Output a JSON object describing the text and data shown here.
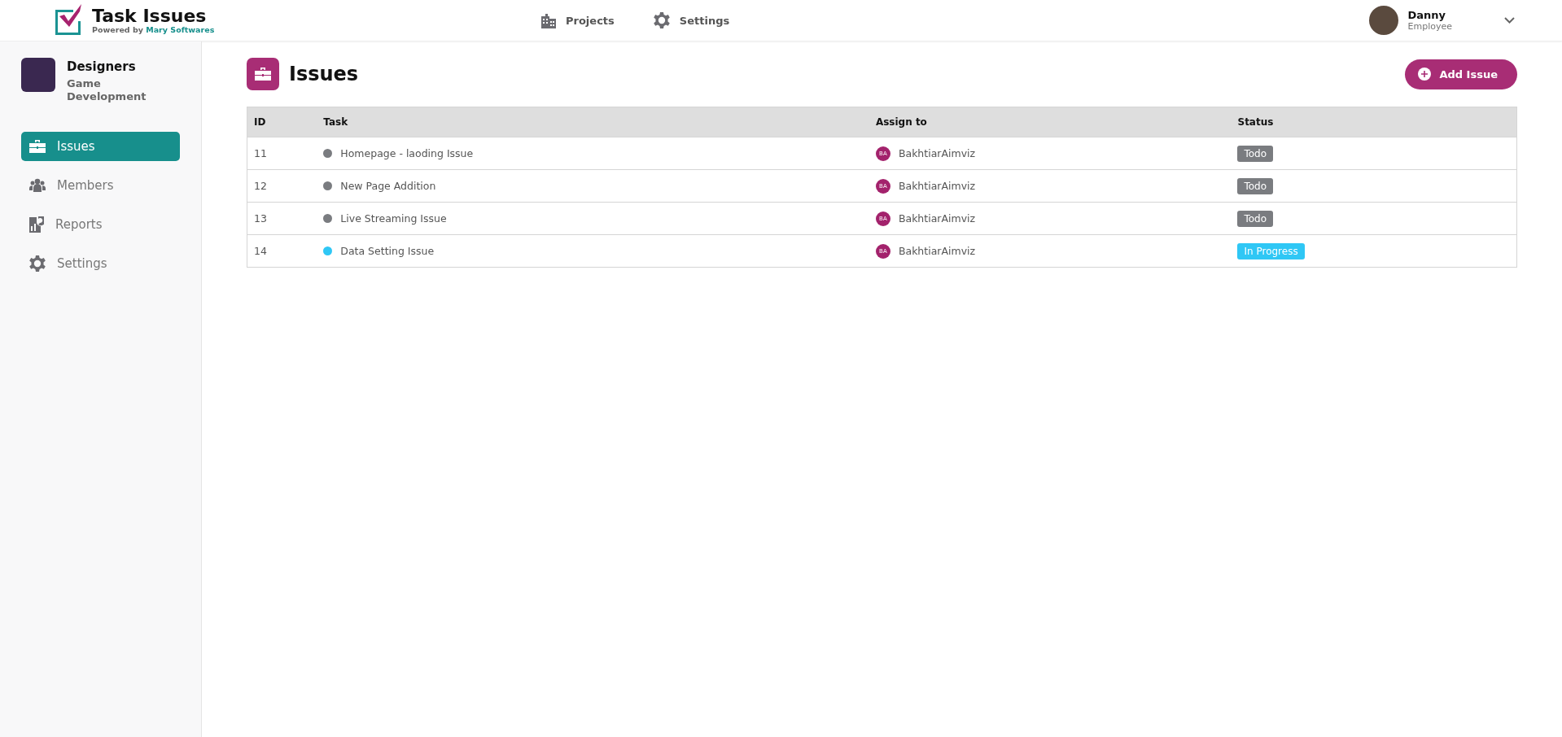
{
  "brand": {
    "title": "Task Issues",
    "powered_prefix": "Powered by",
    "powered_name": "Mary Softwares"
  },
  "nav": [
    {
      "label": "Projects",
      "kind": "building"
    },
    {
      "label": "Settings",
      "kind": "gear"
    }
  ],
  "user": {
    "name": "Danny",
    "role": "Employee"
  },
  "project": {
    "name": "Designers",
    "subtitle": "Game Development"
  },
  "sidebar": {
    "items": [
      {
        "label": "Issues",
        "kind": "briefcase",
        "selected": true
      },
      {
        "label": "Members",
        "kind": "people",
        "selected": false
      },
      {
        "label": "Reports",
        "kind": "report",
        "selected": false
      },
      {
        "label": "Settings",
        "kind": "gear",
        "selected": false
      }
    ]
  },
  "page": {
    "title": "Issues",
    "add_button": "Add Issue"
  },
  "table": {
    "columns": [
      "ID",
      "Task",
      "Assign to",
      "Status"
    ],
    "rows": [
      {
        "id": "11",
        "task": "Homepage - laoding Issue",
        "color": "#7a7c80",
        "initials": "BA",
        "assignee": "BakhtiarAimviz",
        "status": "Todo"
      },
      {
        "id": "12",
        "task": "New Page Addition",
        "color": "#7a7c80",
        "initials": "BA",
        "assignee": "BakhtiarAimviz",
        "status": "Todo"
      },
      {
        "id": "13",
        "task": "Live Streaming Issue",
        "color": "#7a7c80",
        "initials": "BA",
        "assignee": "BakhtiarAimviz",
        "status": "Todo"
      },
      {
        "id": "14",
        "task": "Data Setting Issue",
        "color": "#2fc7f5",
        "initials": "BA",
        "assignee": "BakhtiarAimviz",
        "status": "In Progress"
      }
    ]
  }
}
